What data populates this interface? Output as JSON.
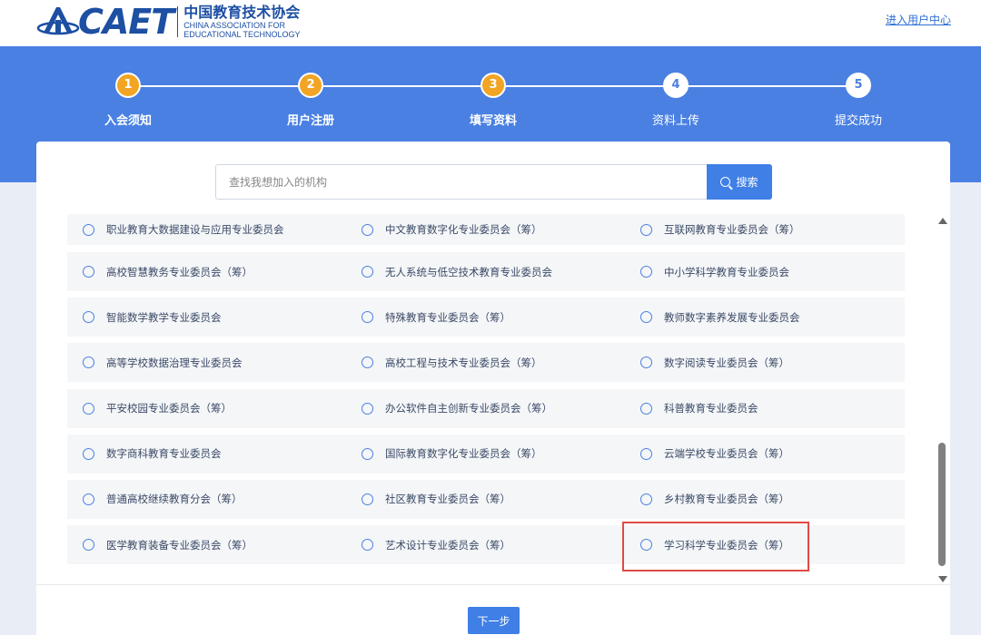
{
  "header": {
    "logo_text": "CAET",
    "org_name_cn": "中国教育技术协会",
    "org_name_en_1": "CHINA ASSOCIATION FOR",
    "org_name_en_2": "EDUCATIONAL TECHNOLOGY",
    "user_center_link": "进入用户中心"
  },
  "steps": [
    {
      "number": "1",
      "label": "入会须知",
      "status": "done"
    },
    {
      "number": "2",
      "label": "用户注册",
      "status": "done"
    },
    {
      "number": "3",
      "label": "填写资料",
      "status": "done"
    },
    {
      "number": "4",
      "label": "资料上传",
      "status": "todo"
    },
    {
      "number": "5",
      "label": "提交成功",
      "status": "todo"
    }
  ],
  "search": {
    "placeholder": "查找我想加入的机构",
    "button_label": "搜索"
  },
  "rows": [
    [
      "职业教育大数据建设与应用专业委员会",
      "中文教育数字化专业委员会（筹）",
      "互联网教育专业委员会（筹）"
    ],
    [
      "高校智慧教务专业委员会（筹）",
      "无人系统与低空技术教育专业委员会",
      "中小学科学教育专业委员会"
    ],
    [
      "智能数学教学专业委员会",
      "特殊教育专业委员会（筹）",
      "教师数字素养发展专业委员会"
    ],
    [
      "高等学校数据治理专业委员会",
      "高校工程与技术专业委员会（筹）",
      "数字阅读专业委员会（筹）"
    ],
    [
      "平安校园专业委员会（筹）",
      "办公软件自主创新专业委员会（筹）",
      "科普教育专业委员会"
    ],
    [
      "数字商科教育专业委员会",
      "国际教育数字化专业委员会（筹）",
      "云端学校专业委员会（筹）"
    ],
    [
      "普通高校继续教育分会（筹）",
      "社区教育专业委员会（筹）",
      "乡村教育专业委员会（筹）"
    ],
    [
      "医学教育装备专业委员会（筹）",
      "艺术设计专业委员会（筹）",
      "学习科学专业委员会（筹）"
    ]
  ],
  "next_button": "下一步",
  "colors": {
    "banner": "#4a80e2",
    "step_done": "#f2a524",
    "primary": "#3f7fe6",
    "highlight": "#e04a44"
  }
}
